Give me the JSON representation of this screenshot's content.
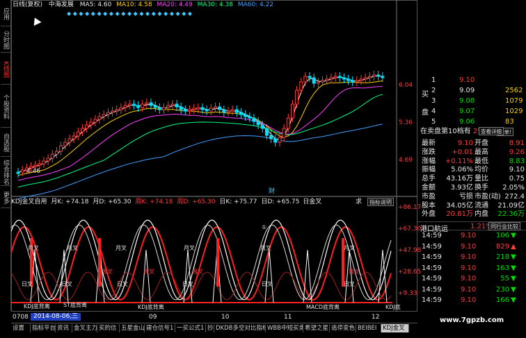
{
  "vertical_tabs": [
    {
      "label": "应用",
      "active": false
    },
    {
      "label": "分时图",
      "active": false
    },
    {
      "label": "K线图",
      "active": true
    },
    {
      "label": "个股资料",
      "active": false
    },
    {
      "label": "自选股",
      "active": false
    },
    {
      "label": "综合排名",
      "active": false
    },
    {
      "label": "更多",
      "active": false
    }
  ],
  "main_header": {
    "period": "日线(复权)",
    "stock_name": "中海发展",
    "ma5": "MA5: 4.60",
    "ma10": "MA10: 4.58",
    "ma20": "MA20: 4.49",
    "ma30": "MA30: 4.38",
    "ma60": "MA60: 4.22"
  },
  "price_axis": [
    "6.04",
    "5.36",
    "4.69"
  ],
  "price_low_label": "4.46",
  "cai_marker": "财",
  "kdj_header": {
    "title": "KDJ金叉自用",
    "month_k": "月K: +74.18",
    "month_d": "月D: +65.30",
    "week_k": "周K: +74.18",
    "week_d": "周D: +65.30",
    "day_k": "日K: +75.77",
    "day_d": "日D: +65.75",
    "day_gold": "日金叉",
    "fragment": "求",
    "explain_button": "指标说明"
  },
  "kdj_axis": [
    "+86.17",
    "+67.30",
    "+47.98",
    "+28.65",
    "+9.33"
  ],
  "kdj_annotations": {
    "yue_cha": "月叉",
    "zhou_cha": "周叉",
    "ri_cha": "日叉",
    "kdj_bottom1": "KDJ底背离",
    "kdj_bottom2": "ST底背离",
    "kdj_bottom3": "KDJ底背离",
    "kdj_bottom4": "MACD底背离",
    "kdj_bottom5": "KDJ底",
    "circle_mark": "①"
  },
  "x_axis": {
    "start": "0708",
    "date_box": "2014-08-06,三",
    "months": [
      "09",
      "10",
      "11",
      "12"
    ]
  },
  "bottom_tabs": [
    "设置",
    "指标平台",
    "资讯",
    "金叉主力",
    "买的信",
    "五星金山",
    "建仓信号1",
    "一买公式1",
    "抄",
    "DKDB多空对比指标",
    "WBB中短买卖",
    "希望之星",
    "逃停变色",
    "BEIBEI",
    "KDJ金叉"
  ],
  "order_book": {
    "buy_label": "买\n盘",
    "rows": [
      {
        "lvl": "1",
        "price": "9.10",
        "vol": ""
      },
      {
        "lvl": "2",
        "price": "9.09",
        "vol": "2562"
      },
      {
        "lvl": "3",
        "price": "9.08",
        "vol": "1079"
      },
      {
        "lvl": "4",
        "price": "9.07",
        "vol": "1029"
      },
      {
        "lvl": "5",
        "price": "9.06",
        "vol": "83"
      }
    ]
  },
  "rank_bar": {
    "text": "在卖盘第10档有",
    "vol": "2591手",
    "sell_btn": "卖单!",
    "detail_btn": "查看详细"
  },
  "quote": [
    {
      "l1": "最新",
      "v1": "9.10",
      "c1": "red",
      "l2": "开盘",
      "v2": "8.91",
      "c2": "red"
    },
    {
      "l1": "涨跌",
      "v1": "+0.01",
      "c1": "red",
      "l2": "最高",
      "v2": "9.26",
      "c2": "red"
    },
    {
      "l1": "涨幅",
      "v1": "+0.11%",
      "c1": "red",
      "l2": "最低",
      "v2": "8.83",
      "c2": "grn"
    },
    {
      "l1": "振幅",
      "v1": "5.06%",
      "c1": "wht",
      "l2": "均价",
      "v2": "9.10",
      "c2": "wht"
    },
    {
      "l1": "总手",
      "v1": "43.16万",
      "c1": "wht",
      "l2": "量比",
      "v2": "0.75",
      "c2": "wht"
    },
    {
      "l1": "金额",
      "v1": "3.93亿",
      "c1": "wht",
      "l2": "换手",
      "v2": "2.05%",
      "c2": "wht"
    },
    {
      "l1": "市盈",
      "v1": "亏损",
      "c1": "wht",
      "l2": "市盈(动)",
      "v2": "272.4",
      "c2": "wht"
    },
    {
      "l1": "股本",
      "v1": "34.05亿",
      "c1": "wht",
      "l2": "流通",
      "v2": "21.09亿",
      "c2": "wht"
    },
    {
      "l1": "外盘",
      "v1": "20.81万",
      "c1": "red",
      "l2": "内盘",
      "v2": "22.36万",
      "c2": "grn"
    }
  ],
  "industry": {
    "name": "港口航运",
    "pct": "1.21%",
    "compare": "同行业比较"
  },
  "ticks": [
    {
      "t": "14:59",
      "p": "9.10",
      "v": "106",
      "d": "down"
    },
    {
      "t": "14:59",
      "p": "9.10",
      "v": "829",
      "d": "up"
    },
    {
      "t": "14:59",
      "p": "9.10",
      "v": "218",
      "d": "down"
    },
    {
      "t": "14:59",
      "p": "9.10",
      "v": "163",
      "d": "down"
    },
    {
      "t": "14:59",
      "p": "9.10",
      "v": "55",
      "d": "down"
    },
    {
      "t": "14:59",
      "p": "9.10",
      "v": "230",
      "d": "down"
    },
    {
      "t": "14:59",
      "p": "9.10",
      "v": "166",
      "d": "down"
    }
  ],
  "watermark": "www.7gpzb.com",
  "colors": {
    "up": "#ff3c3c",
    "down": "#00e000",
    "ma5": "#ffffff",
    "ma10": "#ffd000",
    "ma20": "#ff40ff",
    "ma30": "#00ff80",
    "ma60": "#40a0ff"
  }
}
